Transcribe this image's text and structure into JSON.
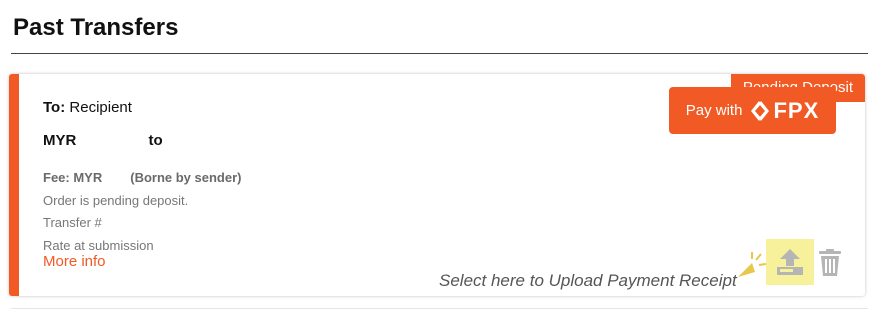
{
  "section": {
    "title": "Past Transfers"
  },
  "transfer": {
    "status": "Pending Deposit",
    "to_label": "To:",
    "recipient": "Recipient",
    "currency": "MYR",
    "to_word": "to",
    "fee_label": "Fee: MYR",
    "fee_note": "(Borne by sender)",
    "order_status": "Order is pending deposit.",
    "transfer_no_label": "Transfer #",
    "rate_label": "Rate at submission",
    "more_info": "More info",
    "pay_label": "Pay with",
    "pay_brand": "FPX",
    "upload_hint": "Select here to Upload Payment Receipt"
  },
  "colors": {
    "accent": "#f15a24",
    "highlight": "#f7f19b",
    "cursor": "#e6c84a",
    "icon_gray": "#b5b5b5"
  },
  "icons": {
    "upload": "upload-receipt-icon",
    "trash": "trash-icon",
    "cursor": "pointer-cursor-icon",
    "brand": "fpx-logo-icon"
  }
}
